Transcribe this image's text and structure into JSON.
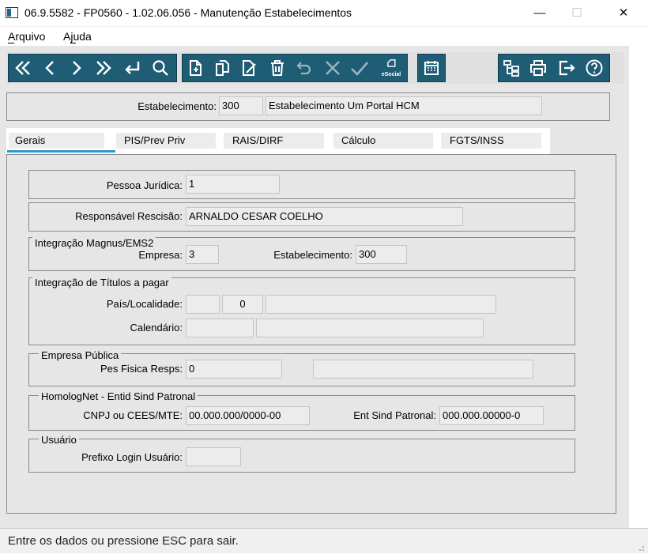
{
  "window": {
    "title": "06.9.5582 - FP0560 - 1.02.06.056 - Manutenção Estabelecimentos",
    "minimize": "—",
    "maximize": "☐",
    "close": "✕"
  },
  "menu": {
    "items": [
      "Arquivo",
      "Ajuda"
    ]
  },
  "toolbar": {
    "groups": [
      [
        "first-record-icon",
        "previous-record-icon",
        "next-record-icon",
        "last-record-icon",
        "go-to-icon",
        "search-icon"
      ],
      [
        "new-icon",
        "copy-icon",
        "edit-icon",
        "delete-icon",
        "undo-icon",
        "cancel-icon",
        "confirm-icon",
        "esocial-icon"
      ],
      [
        "calendar-icon"
      ],
      [
        "tree-icon",
        "print-icon",
        "exit-icon",
        "help-icon"
      ]
    ],
    "esocial_label": "eSocial",
    "accent_color": "#1f5d75"
  },
  "header": {
    "estabelecimento_label": "Estabelecimento:",
    "estabelecimento_code": "300",
    "estabelecimento_name": "Estabelecimento Um Portal HCM"
  },
  "tabs": [
    {
      "label": "Gerais",
      "active": true
    },
    {
      "label": "PIS/Prev Priv",
      "active": false
    },
    {
      "label": "RAIS/DIRF",
      "active": false
    },
    {
      "label": "Cálculo",
      "active": false
    },
    {
      "label": "FGTS/INSS",
      "active": false
    }
  ],
  "gerais": {
    "pessoa_juridica_label": "Pessoa Jurídica:",
    "pessoa_juridica_value": "1",
    "responsavel_label": "Responsável Rescisão:",
    "responsavel_value": "ARNALDO CESAR COELHO",
    "magnus": {
      "legend": "Integração Magnus/EMS2",
      "empresa_label": "Empresa:",
      "empresa_value": "3",
      "estab_label": "Estabelecimento:",
      "estab_value": "300"
    },
    "titulos": {
      "legend": "Integração de Títulos a pagar",
      "pais_label": "País/Localidade:",
      "pais_value": "",
      "localidade_value": "0",
      "localidade_desc": "",
      "calendario_label": "Calendário:",
      "calendario_value": "",
      "calendario_desc": ""
    },
    "publica": {
      "legend": "Empresa Pública",
      "pes_label": "Pes Fisica Resps:",
      "pes_value": "0",
      "pes_desc": ""
    },
    "homolognet": {
      "legend": "HomologNet - Entid Sind Patronal",
      "cnpj_label": "CNPJ ou CEES/MTE:",
      "cnpj_value": "00.000.000/0000-00",
      "ent_label": "Ent Sind Patronal:",
      "ent_value": "000.000.00000-0"
    },
    "usuario": {
      "legend": "Usuário",
      "prefixo_label": "Prefixo Login Usuário:",
      "prefixo_value": ""
    }
  },
  "status": {
    "message": "Entre os dados ou pressione ESC para sair."
  }
}
